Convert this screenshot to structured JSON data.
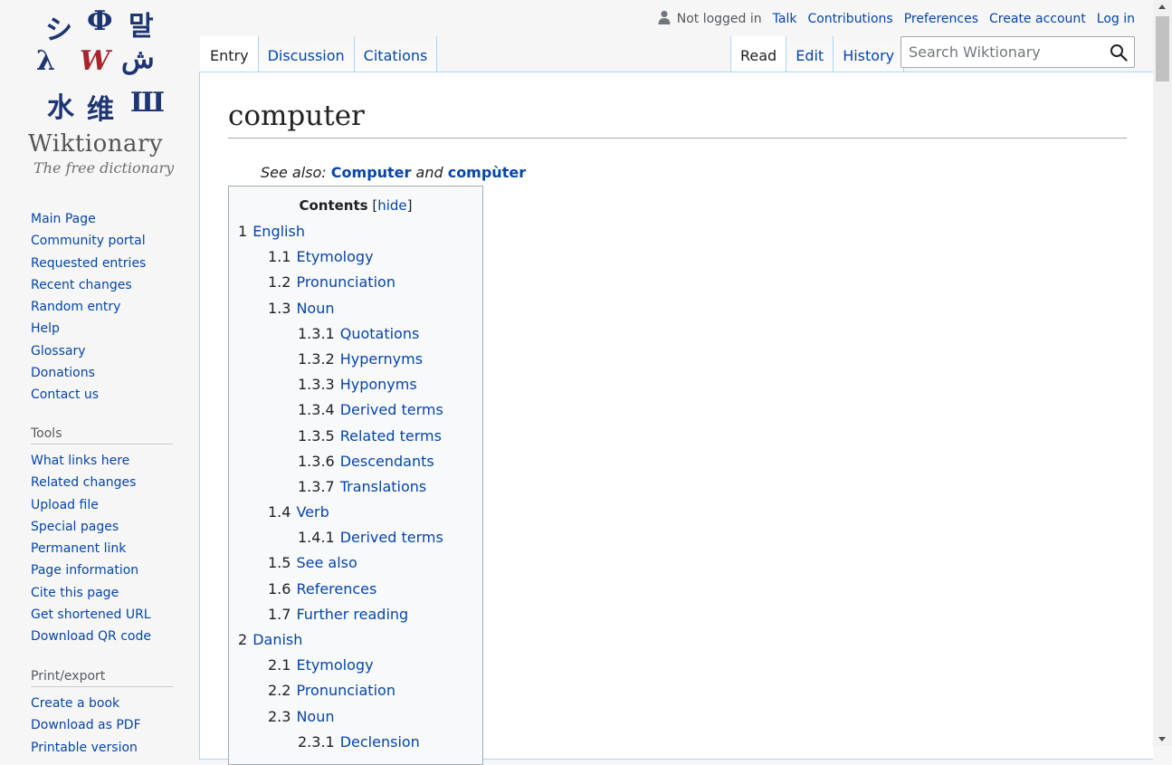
{
  "logo": {
    "glyphs": [
      "シ",
      "Ф",
      "말",
      "λ",
      "W",
      "ش",
      "水",
      "维",
      "Ш"
    ],
    "wordmark": "Wiktionary",
    "tagline": "The free dictionary"
  },
  "sidebar": {
    "navigation": [
      "Main Page",
      "Community portal",
      "Requested entries",
      "Recent changes",
      "Random entry",
      "Help",
      "Glossary",
      "Donations",
      "Contact us"
    ],
    "tools_heading": "Tools",
    "tools": [
      "What links here",
      "Related changes",
      "Upload file",
      "Special pages",
      "Permanent link",
      "Page information",
      "Cite this page",
      "Get shortened URL",
      "Download QR code"
    ],
    "print_heading": "Print/export",
    "print": [
      "Create a book",
      "Download as PDF",
      "Printable version"
    ]
  },
  "personal": {
    "status": "Not logged in",
    "links": [
      "Talk",
      "Contributions",
      "Preferences",
      "Create account",
      "Log in"
    ]
  },
  "tabs": {
    "left": [
      "Entry",
      "Discussion",
      "Citations"
    ],
    "right": [
      "Read",
      "Edit",
      "History"
    ]
  },
  "search": {
    "placeholder": "Search Wiktionary"
  },
  "page": {
    "title": "computer",
    "see_also_prefix": "See also: ",
    "see_also_1": "Computer",
    "see_also_and": " and ",
    "see_also_2": "compùter"
  },
  "toc": {
    "title": "Contents",
    "hide_open": "[",
    "hide": "hide",
    "hide_close": "]",
    "items": [
      {
        "num": "1",
        "label": "English",
        "level": 1
      },
      {
        "num": "1.1",
        "label": "Etymology",
        "level": 2
      },
      {
        "num": "1.2",
        "label": "Pronunciation",
        "level": 2
      },
      {
        "num": "1.3",
        "label": "Noun",
        "level": 2
      },
      {
        "num": "1.3.1",
        "label": "Quotations",
        "level": 3
      },
      {
        "num": "1.3.2",
        "label": "Hypernyms",
        "level": 3
      },
      {
        "num": "1.3.3",
        "label": "Hyponyms",
        "level": 3
      },
      {
        "num": "1.3.4",
        "label": "Derived terms",
        "level": 3
      },
      {
        "num": "1.3.5",
        "label": "Related terms",
        "level": 3
      },
      {
        "num": "1.3.6",
        "label": "Descendants",
        "level": 3
      },
      {
        "num": "1.3.7",
        "label": "Translations",
        "level": 3
      },
      {
        "num": "1.4",
        "label": "Verb",
        "level": 2
      },
      {
        "num": "1.4.1",
        "label": "Derived terms",
        "level": 3
      },
      {
        "num": "1.5",
        "label": "See also",
        "level": 2
      },
      {
        "num": "1.6",
        "label": "References",
        "level": 2
      },
      {
        "num": "1.7",
        "label": "Further reading",
        "level": 2
      },
      {
        "num": "2",
        "label": "Danish",
        "level": 1
      },
      {
        "num": "2.1",
        "label": "Etymology",
        "level": 2
      },
      {
        "num": "2.2",
        "label": "Pronunciation",
        "level": 2
      },
      {
        "num": "2.3",
        "label": "Noun",
        "level": 2
      },
      {
        "num": "2.3.1",
        "label": "Declension",
        "level": 3
      }
    ]
  },
  "colors": {
    "link": "#0645ad",
    "tab_border": "#a7d7f9",
    "background": "#f6f6f6"
  }
}
